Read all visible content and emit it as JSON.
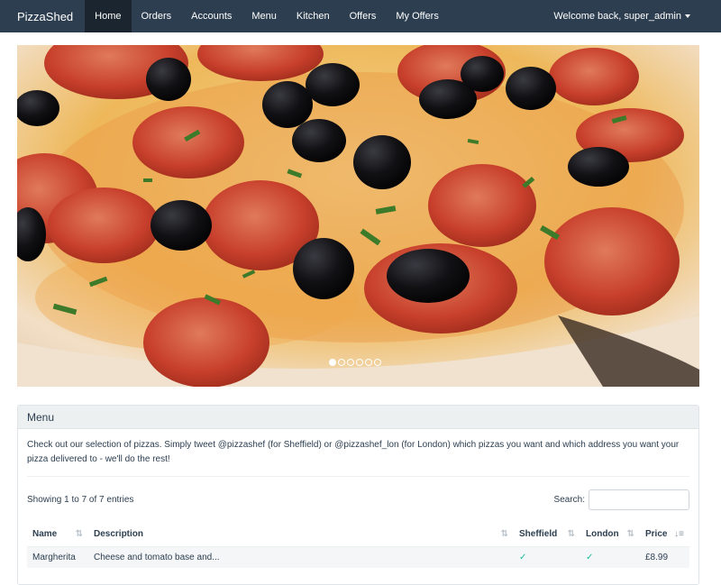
{
  "navbar": {
    "brand": "PizzaShed",
    "items": [
      {
        "label": "Home"
      },
      {
        "label": "Orders"
      },
      {
        "label": "Accounts"
      },
      {
        "label": "Menu"
      },
      {
        "label": "Kitchen"
      },
      {
        "label": "Offers"
      },
      {
        "label": "My Offers"
      }
    ],
    "active_index": 0,
    "user_menu": "Welcome back, super_admin"
  },
  "carousel": {
    "slide_count": 6,
    "active_index": 0,
    "image_subject": "pepperoni and olive pizza"
  },
  "menu_panel": {
    "heading": "Menu",
    "description": "Check out our selection of pizzas. Simply tweet @pizzashef (for Sheffield) or @pizzashef_lon (for London) which pizzas you want and which address you want your pizza delivered to - we'll do the rest!",
    "table": {
      "info": "Showing 1 to 7 of 7 entries",
      "search_label": "Search:",
      "search_value": "",
      "columns": [
        "Name",
        "Description",
        "Sheffield",
        "London",
        "Price"
      ],
      "sort_icon": "sort-arrows-icon",
      "sorted_icon": "sort-amount-asc-icon",
      "first_row_partial": [
        "Margherita",
        "Cheese and tomato base and...",
        "",
        "",
        "£8.99"
      ]
    }
  },
  "colors": {
    "navbar_bg": "#2c3e50",
    "navbar_active": "#1a252f",
    "panel_heading_bg": "#ecf0f1",
    "text": "#2c3e50",
    "tick_green": "#18bc9c"
  }
}
